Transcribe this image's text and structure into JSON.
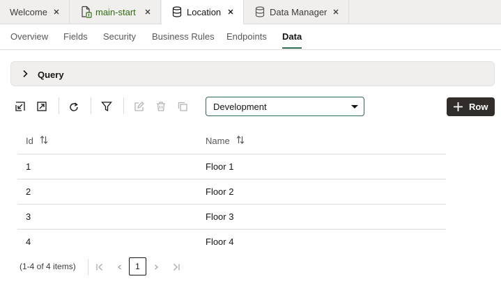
{
  "tabs": [
    {
      "label": "Welcome",
      "icon": "none"
    },
    {
      "label": "main-start",
      "icon": "git-page-icon"
    },
    {
      "label": "Location",
      "icon": "database-icon"
    },
    {
      "label": "Data Manager",
      "icon": "database-icon"
    }
  ],
  "active_tab": "Location",
  "subtabs": [
    "Overview",
    "Fields",
    "Security",
    "Business Rules",
    "Endpoints",
    "Data"
  ],
  "active_subtab": "Data",
  "query": {
    "label": "Query"
  },
  "environment": {
    "selected": "Development"
  },
  "add_row": {
    "label": "Row"
  },
  "table": {
    "columns": [
      "Id",
      "Name"
    ],
    "rows": [
      {
        "id": "1",
        "name": "Floor 1"
      },
      {
        "id": "2",
        "name": "Floor 2"
      },
      {
        "id": "3",
        "name": "Floor 3"
      },
      {
        "id": "4",
        "name": "Floor 4"
      }
    ]
  },
  "pagination": {
    "info": "(1-4 of 4 items)",
    "current_page": "1"
  },
  "colors": {
    "accent": "#2e6b50",
    "button_dark": "#312d2a",
    "git_green": "#2e6b0e"
  }
}
